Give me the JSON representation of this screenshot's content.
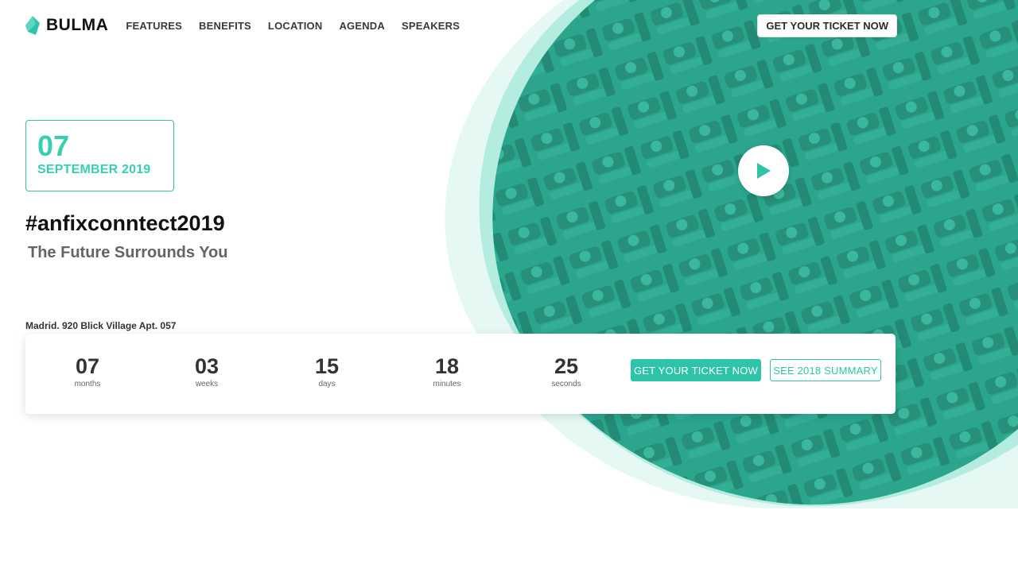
{
  "brand": {
    "name": "BULMA"
  },
  "nav": {
    "links": [
      "FEATURES",
      "BENEFITS",
      "LOCATION",
      "AGENDA",
      "SPEAKERS"
    ],
    "cta": "GET YOUR TICKET NOW"
  },
  "event": {
    "day": "07",
    "month_year": "SEPTEMBER 2019",
    "hashtag": "#anfixconntect2019",
    "tagline": "The Future Surrounds You",
    "address": "Madrid. 920 Blick Village Apt. 057"
  },
  "countdown": {
    "units": [
      {
        "value": "07",
        "label": "months"
      },
      {
        "value": "03",
        "label": "weeks"
      },
      {
        "value": "15",
        "label": "days"
      },
      {
        "value": "18",
        "label": "minutes"
      },
      {
        "value": "25",
        "label": "seconds"
      }
    ],
    "primary_cta": "GET YOUR TICKET NOW",
    "secondary_cta": "SEE 2018 SUMMARY"
  },
  "colors": {
    "accent": "#2ec4a8",
    "blob_light": "#e6f8f3",
    "blob_mid": "#b4ede0",
    "image_tint": "#2a9d85"
  },
  "icons": {
    "play": "play-icon",
    "logo": "bulma-logo-icon"
  }
}
